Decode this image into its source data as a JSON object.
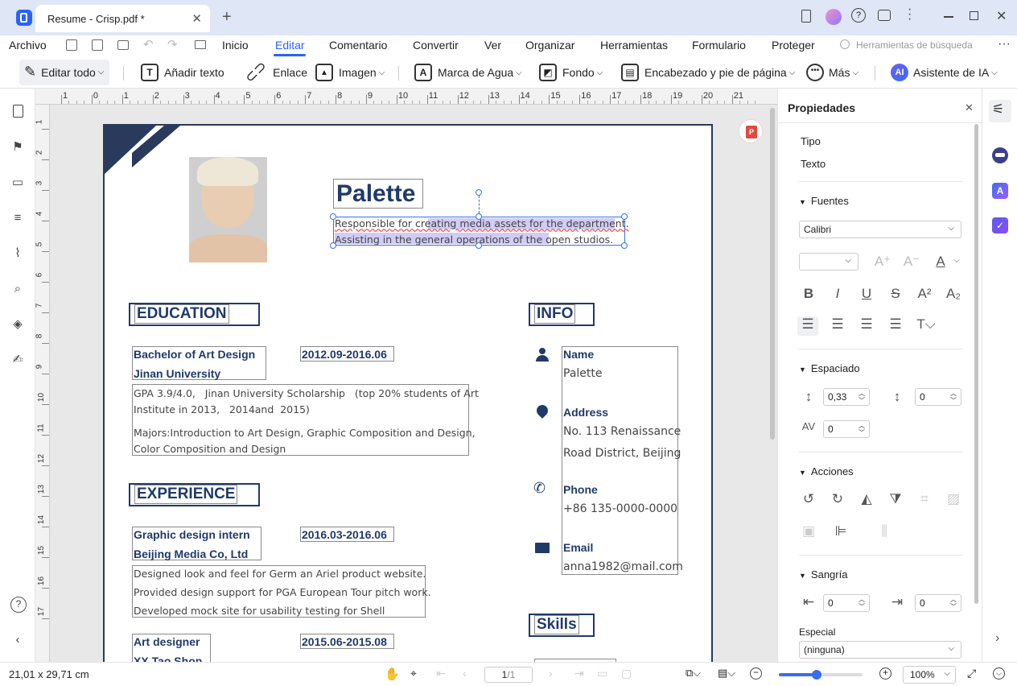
{
  "window": {
    "tab_title": "Resume - Crisp.pdf *",
    "new_tab": "+",
    "close_tab": "✕"
  },
  "menu": {
    "file": "Archivo",
    "items": [
      "Inicio",
      "Editar",
      "Comentario",
      "Convertir",
      "Ver",
      "Organizar",
      "Herramientas",
      "Formulario",
      "Proteger"
    ],
    "active": "Editar",
    "search_placeholder": "Herramientas de búsqueda",
    "more": "···"
  },
  "toolbar": {
    "edit_all": "Editar todo",
    "add_text": "Añadir texto",
    "link": "Enlace",
    "image": "Imagen",
    "watermark": "Marca de Agua",
    "background": "Fondo",
    "header_footer": "Encabezado y pie de página",
    "more": "Más",
    "ai": "Asistente de IA"
  },
  "ruler": {
    "ticks": [
      "1",
      "0",
      "1",
      "2",
      "3",
      "4",
      "5",
      "6",
      "7",
      "8",
      "9",
      "10",
      "11",
      "12",
      "13",
      "14",
      "15",
      "16",
      "17",
      "18",
      "19",
      "20",
      "21"
    ]
  },
  "document": {
    "name": "Palette",
    "intro_lines": [
      "Responsible for creating media assets for the department.",
      "Assisting in the general operations of the open studios."
    ],
    "education": {
      "heading": "EDUCATION",
      "degree": "Bachelor of Art Design",
      "dates": "2012.09-2016.06",
      "school": "Jinan University",
      "gpa_lines": [
        "GPA 3.9/4.0,   Jinan University Scholarship   (top 20% students of Art",
        "Institute in 2013,   2014and  2015)"
      ],
      "majors_lines": [
        "Majors:Introduction to Art Design, Graphic Composition and Design,",
        "Color Composition and Design"
      ]
    },
    "experience": {
      "heading": "EXPERIENCE",
      "job1_title": "Graphic design intern",
      "job1_dates": "2016.03-2016.06",
      "job1_company": "Beijing Media Co, Ltd",
      "job1_lines": [
        "Designed look and feel for Germ an Ariel product website.",
        "Provided design support for PGA European Tour pitch work.",
        "Developed mock site for usability testing for Shell"
      ],
      "job2_title": "Art designer",
      "job2_dates": "2015.06-2015.08",
      "job2_company": "XX Tao Shop"
    },
    "info": {
      "heading": "INFO",
      "name_label": "Name",
      "name_value": "Palette",
      "address_label": "Address",
      "address_lines": [
        "No. 113 Renaissance",
        "Road District, Beijing"
      ],
      "phone_label": "Phone",
      "phone_value": "+86 135-0000-0000",
      "email_label": "Email",
      "email_value": "anna1982@mail.com"
    },
    "skills": {
      "heading": "Skills"
    }
  },
  "properties": {
    "title": "Propiedades",
    "type_label": "Tipo",
    "type_value": "Texto",
    "fonts_label": "Fuentes",
    "font_value": "Calibri",
    "spacing_label": "Espaciado",
    "line_spacing": "0,33",
    "para_spacing": "0",
    "char_spacing": "0",
    "actions_label": "Acciones",
    "indent_label": "Sangría",
    "indent_left": "0",
    "indent_right": "0",
    "special_label": "Especial",
    "special_value": "(ninguna)"
  },
  "status": {
    "dimensions": "21,01 x 29,71 cm",
    "page": "1",
    "page_total": "/1",
    "zoom": "100%",
    "zoom_level": 0.45
  },
  "colors": {
    "accent": "#1f3a6a",
    "selection": "#3a6ef0"
  }
}
